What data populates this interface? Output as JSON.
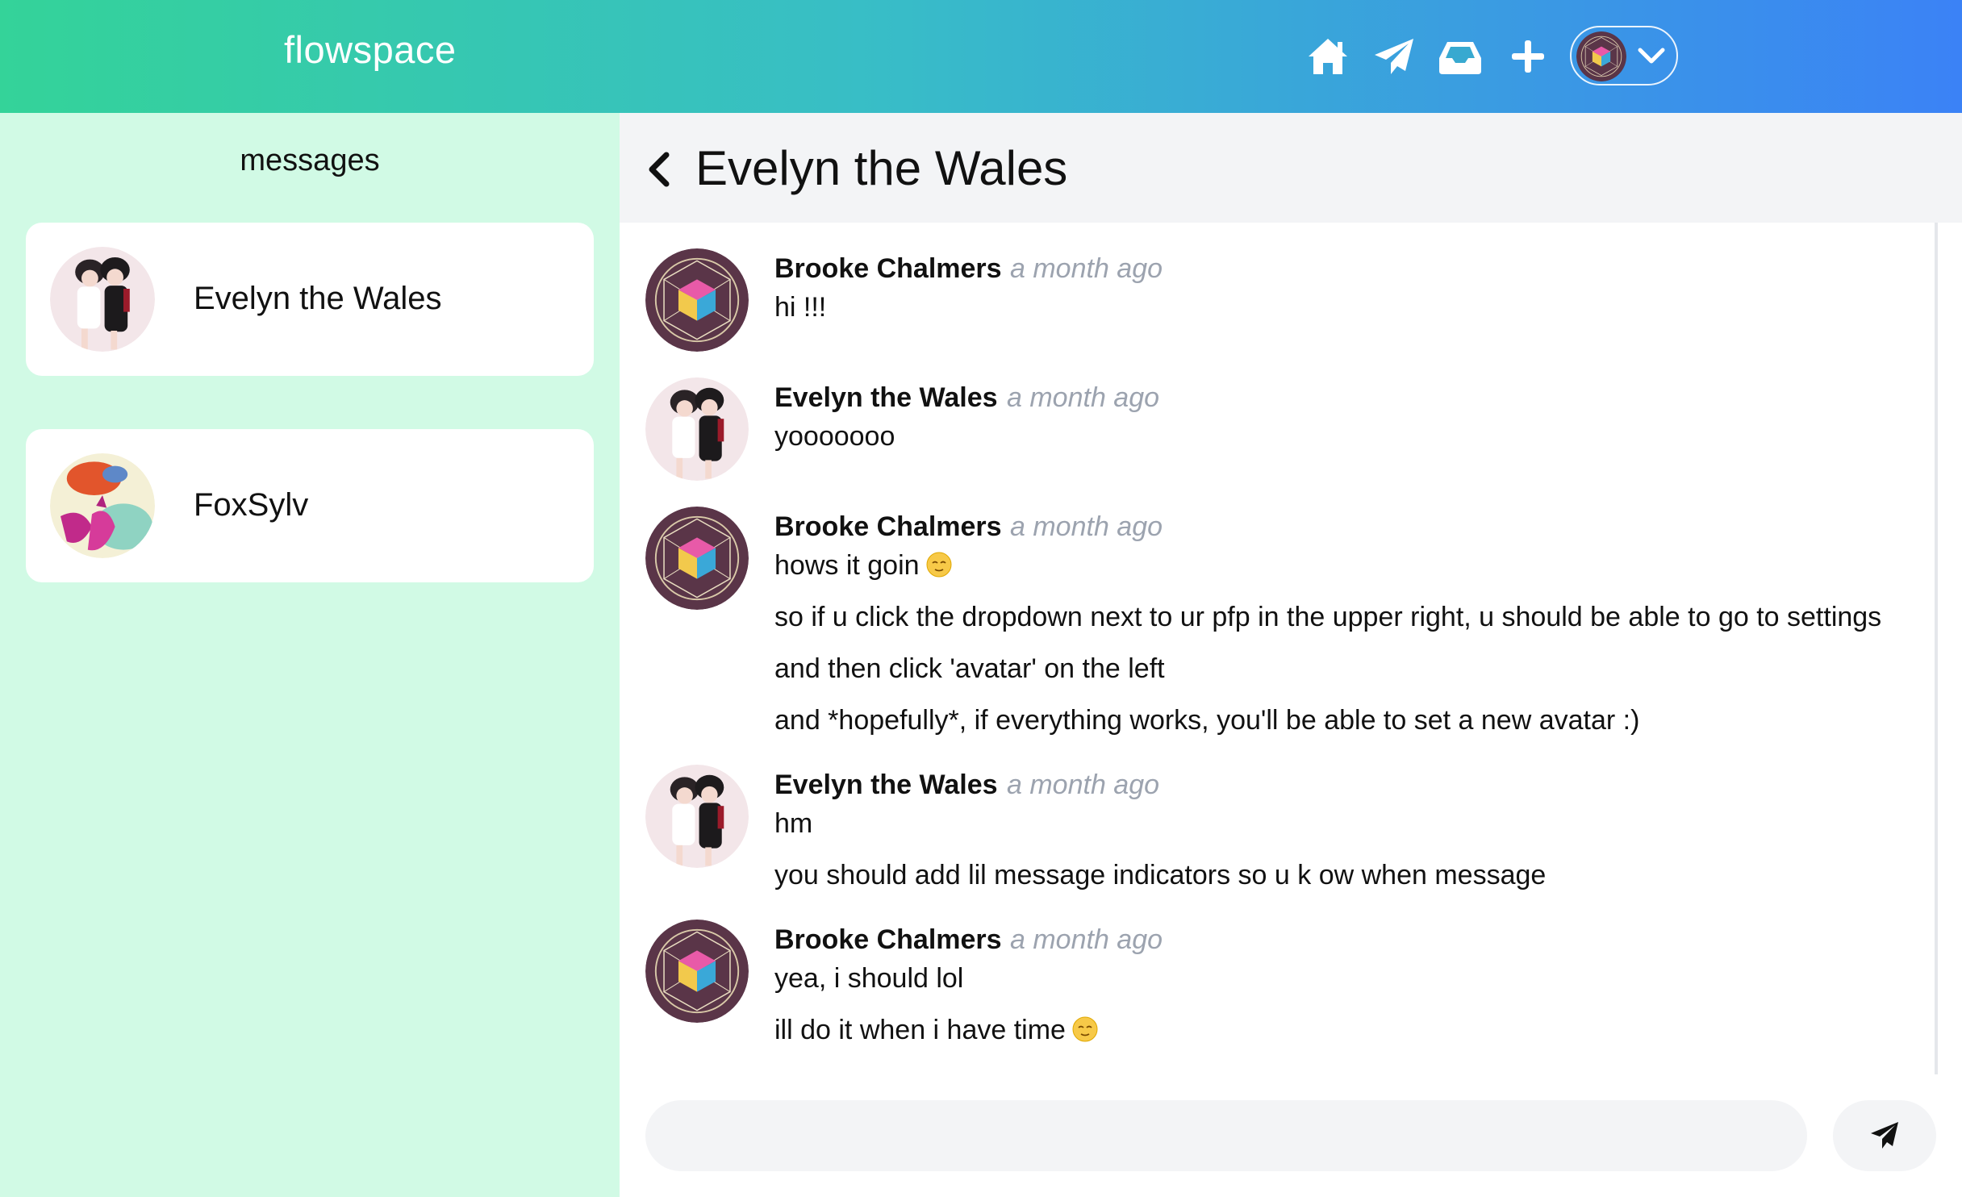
{
  "app": {
    "brand": "flowspace"
  },
  "nav": {
    "icons": [
      "home-icon",
      "paper-plane-icon",
      "inbox-icon",
      "plus-icon"
    ],
    "account_dropdown": "chevron-down-icon"
  },
  "sidebar": {
    "title": "messages",
    "conversations": [
      {
        "name": "Evelyn the Wales",
        "avatar": "anime-duo-avatar"
      },
      {
        "name": "FoxSylv",
        "avatar": "fox-avatar"
      }
    ]
  },
  "chat": {
    "title": "Evelyn the Wales",
    "messages": [
      {
        "sender": "Brooke Chalmers",
        "time": "a month ago",
        "lines": [
          "hi !!!"
        ]
      },
      {
        "sender": "Evelyn the Wales",
        "time": "a month ago",
        "lines": [
          "yooooooo"
        ]
      },
      {
        "sender": "Brooke Chalmers",
        "time": "a month ago",
        "lines": [
          "hows it goin",
          "so if u click the dropdown next to ur pfp in the upper right, u should be able to go to settings",
          "and then click 'avatar' on the left",
          "and *hopefully*, if everything works, you'll be able to set a new avatar :)"
        ]
      },
      {
        "sender": "Evelyn the Wales",
        "time": "a month ago",
        "lines": [
          "hm",
          "you should add lil message indicators so u k ow when message"
        ]
      },
      {
        "sender": "Brooke Chalmers",
        "time": "a month ago",
        "lines": [
          "yea, i should lol",
          "ill do it when i have time"
        ]
      }
    ],
    "composer": {
      "value": "",
      "placeholder": ""
    }
  },
  "colors": {
    "topbar_start": "#34d399",
    "topbar_end": "#3b82f6",
    "sidebar_bg": "#d1fae5",
    "timestamp": "#9ca3af"
  }
}
